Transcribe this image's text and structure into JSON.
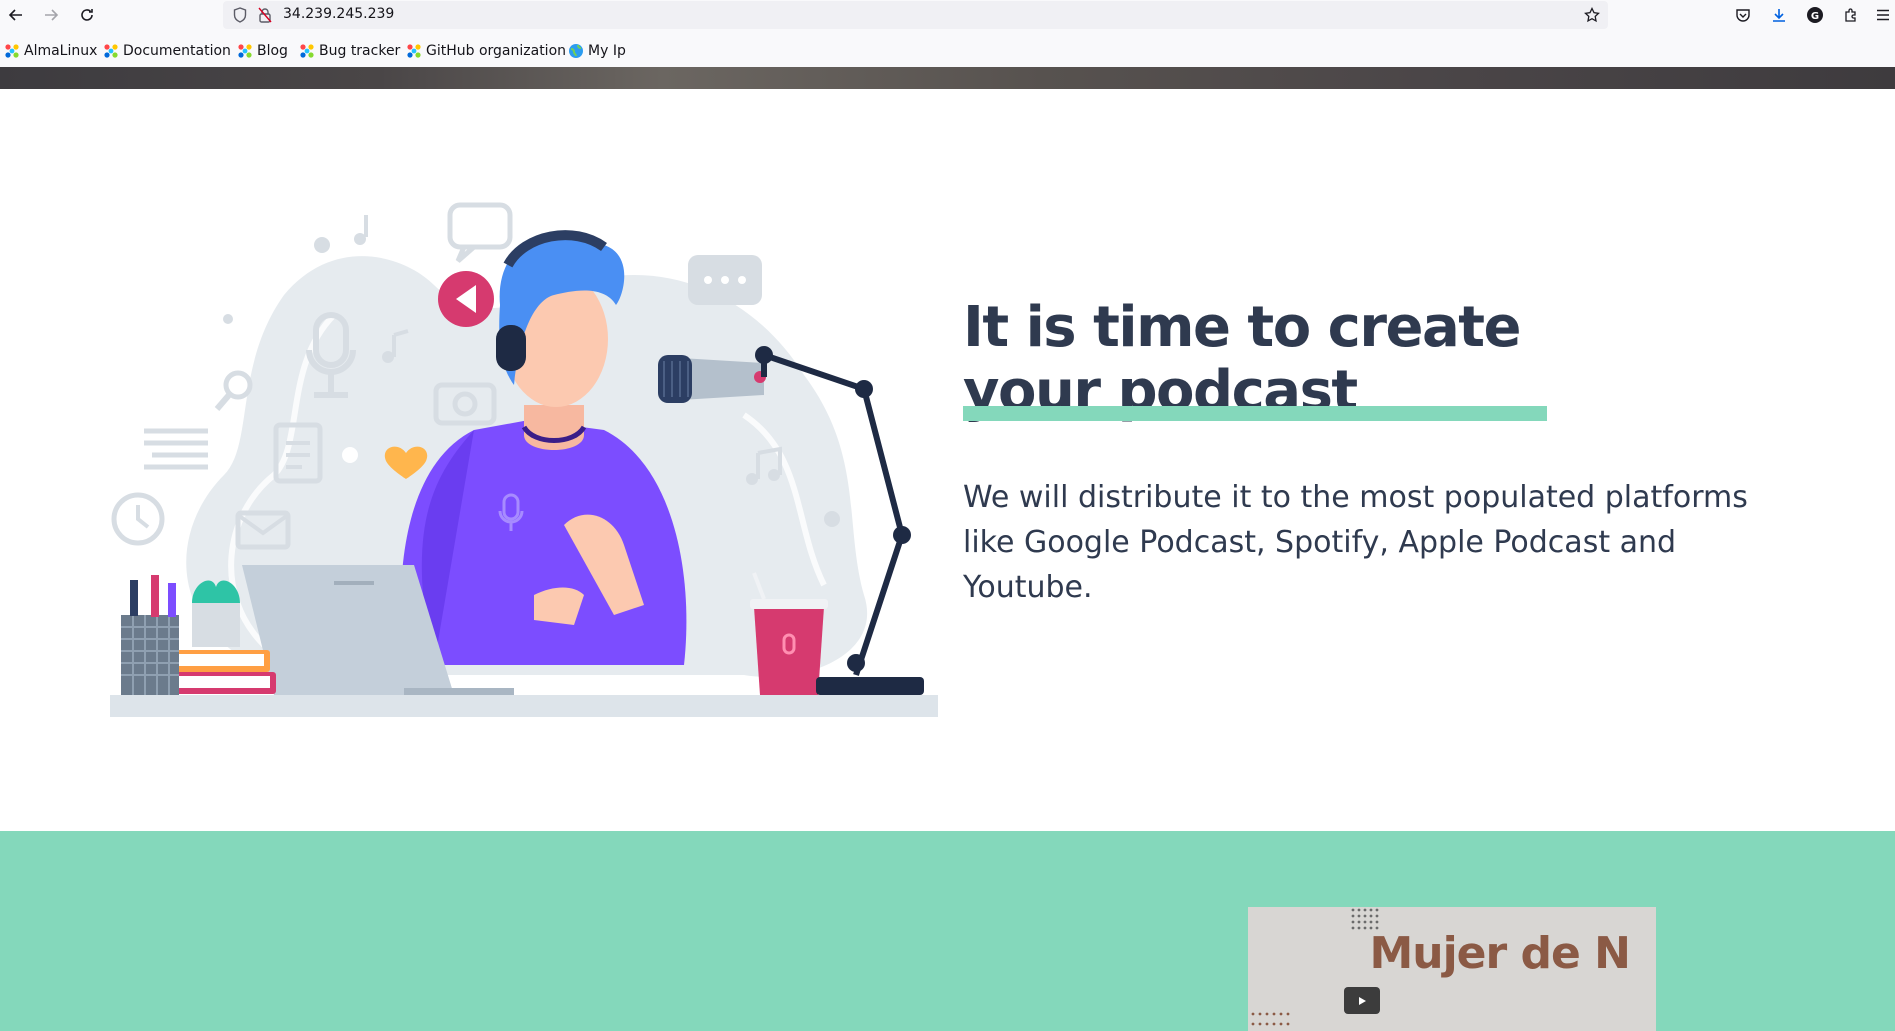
{
  "browser": {
    "url": "34.239.245.239",
    "bookmarks": [
      {
        "label": "AlmaLinux",
        "icon": "almalinux-icon"
      },
      {
        "label": "Documentation",
        "icon": "almalinux-icon"
      },
      {
        "label": "Blog",
        "icon": "almalinux-icon"
      },
      {
        "label": "Bug tracker",
        "icon": "almalinux-icon"
      },
      {
        "label": "GitHub organization",
        "icon": "almalinux-icon"
      },
      {
        "label": "My Ip",
        "icon": "globe-icon"
      }
    ]
  },
  "section_intro": {
    "headline": "It is time to create your podcast",
    "lead": "We will distribute it to the most populated platforms like Google Podcast, Spotify, Apple Podcast and Youtube.",
    "underline_color": "#84d8bb",
    "text_color": "#2f3a4f"
  },
  "section_video": {
    "background": "#84d8bb",
    "card_title": "Mujer de N",
    "card_title_color": "#8b5a45"
  }
}
